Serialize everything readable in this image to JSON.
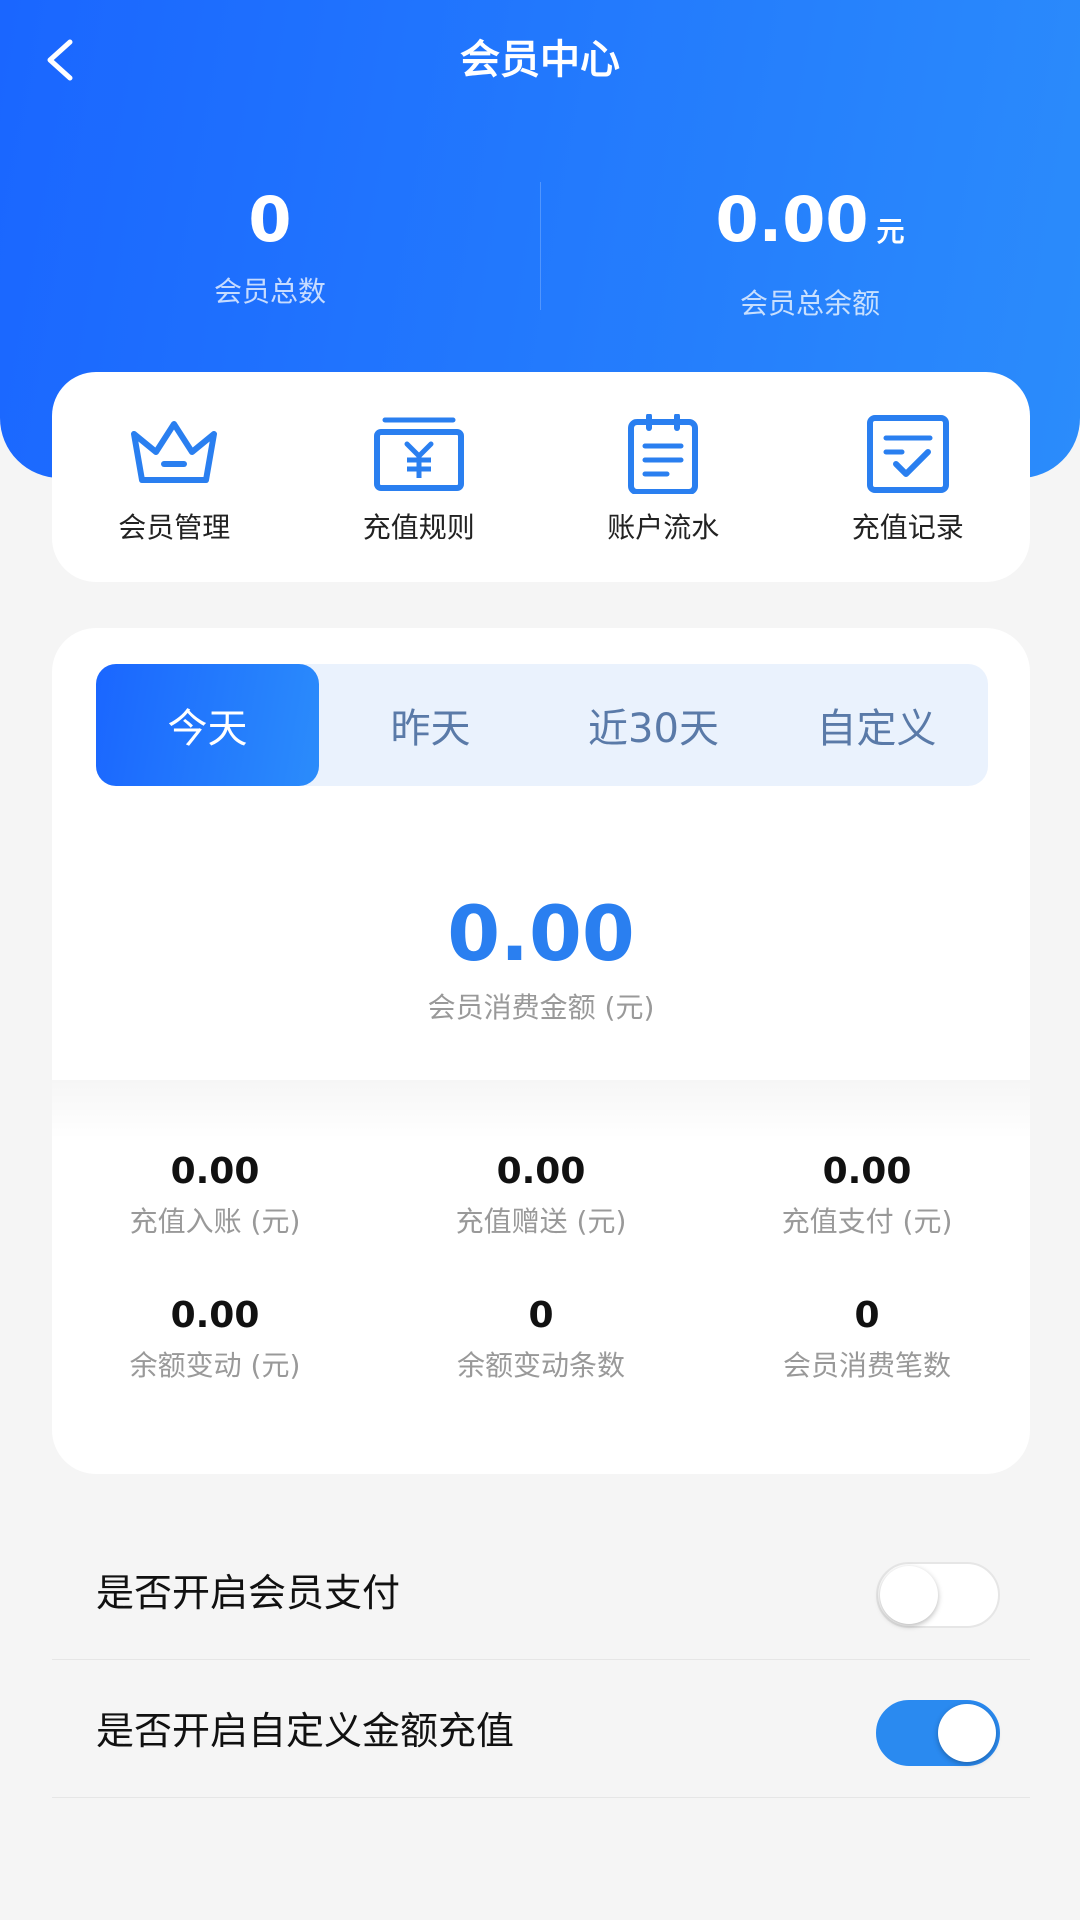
{
  "header": {
    "title": "会员中心",
    "back_icon": "chevron-left-icon"
  },
  "summary": {
    "member_count": "0",
    "member_count_label": "会员总数",
    "total_balance": "0.00",
    "total_balance_unit": "元",
    "total_balance_label": "会员总余额"
  },
  "menu": [
    {
      "label": "会员管理",
      "icon": "crown-icon"
    },
    {
      "label": "充值规则",
      "icon": "yen-bill-icon"
    },
    {
      "label": "账户流水",
      "icon": "clipboard-list-icon"
    },
    {
      "label": "充值记录",
      "icon": "checklist-icon"
    }
  ],
  "tabs": {
    "items": [
      "今天",
      "昨天",
      "近30天",
      "自定义"
    ],
    "active": "今天"
  },
  "consumption": {
    "value": "0.00",
    "label": "会员消费金额 (元)"
  },
  "metrics": [
    {
      "value": "0.00",
      "label": "充值入账 (元)"
    },
    {
      "value": "0.00",
      "label": "充值赠送 (元)"
    },
    {
      "value": "0.00",
      "label": "充值支付 (元)"
    },
    {
      "value": "0.00",
      "label": "余额变动 (元)"
    },
    {
      "value": "0",
      "label": "余额变动条数"
    },
    {
      "value": "0",
      "label": "会员消费笔数"
    }
  ],
  "settings": [
    {
      "label": "是否开启会员支付",
      "enabled": false
    },
    {
      "label": "是否开启自定义金额充值",
      "enabled": true
    }
  ],
  "colors": {
    "primary": "#1a66ff",
    "accent": "#2b8cfb",
    "value_blue": "#2a7ff0",
    "background": "#f5f5f5"
  }
}
